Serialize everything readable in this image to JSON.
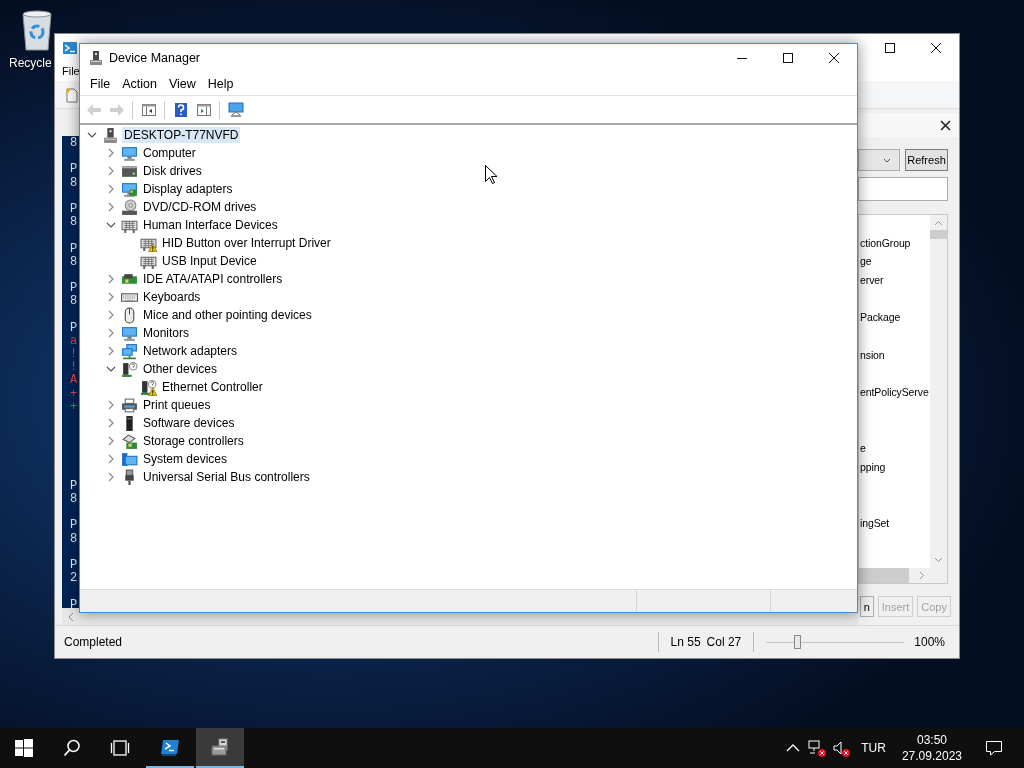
{
  "desktop_icons": [
    {
      "label": "Recycle"
    }
  ],
  "background_window": {
    "menu": [
      "File"
    ],
    "console_lines": [
      {
        "kind": "output",
        "text": "8"
      },
      {
        "kind": "blank"
      },
      {
        "kind": "output",
        "text": "P"
      },
      {
        "kind": "output",
        "text": "8"
      },
      {
        "kind": "blank"
      },
      {
        "kind": "output",
        "text": "P"
      },
      {
        "kind": "output",
        "text": "8"
      },
      {
        "kind": "blank"
      },
      {
        "kind": "output",
        "text": "P"
      },
      {
        "kind": "output",
        "text": "8"
      },
      {
        "kind": "blank"
      },
      {
        "kind": "output",
        "text": "P"
      },
      {
        "kind": "output",
        "text": "8"
      },
      {
        "kind": "blank"
      },
      {
        "kind": "output",
        "text": "P"
      },
      {
        "kind": "error",
        "text": "a"
      },
      {
        "kind": "error",
        "text": "!"
      },
      {
        "kind": "error",
        "text": "!"
      },
      {
        "kind": "error",
        "text": "A"
      },
      {
        "kind": "error",
        "text": "+"
      },
      {
        "kind": "error",
        "text": "+"
      },
      {
        "kind": "blank"
      },
      {
        "kind": "blank"
      },
      {
        "kind": "blank"
      },
      {
        "kind": "blank"
      },
      {
        "kind": "blank"
      },
      {
        "kind": "output",
        "text": "P"
      },
      {
        "kind": "output",
        "text": "8"
      },
      {
        "kind": "blank"
      },
      {
        "kind": "output",
        "text": "P"
      },
      {
        "kind": "output",
        "text": "8"
      },
      {
        "kind": "blank"
      },
      {
        "kind": "output",
        "text": "P"
      },
      {
        "kind": "output",
        "text": "2"
      },
      {
        "kind": "blank"
      },
      {
        "kind": "output",
        "text": "P"
      }
    ],
    "commands_pane": {
      "refresh_button": "Refresh",
      "commands": [
        {
          "kind": "covered"
        },
        {
          "kind": "text",
          "text": "ctionGroup"
        },
        {
          "kind": "text",
          "text": "ge"
        },
        {
          "kind": "text",
          "text": "erver"
        },
        {
          "kind": "covered"
        },
        {
          "kind": "text",
          "text": "Package"
        },
        {
          "kind": "covered"
        },
        {
          "kind": "text",
          "text": "nsion"
        },
        {
          "kind": "covered"
        },
        {
          "kind": "text",
          "text": "entPolicyServe"
        },
        {
          "kind": "covered"
        },
        {
          "kind": "covered"
        },
        {
          "kind": "text",
          "text": "e"
        },
        {
          "kind": "text",
          "text": "pping"
        },
        {
          "kind": "covered"
        },
        {
          "kind": "covered"
        },
        {
          "kind": "text",
          "text": "ingSet"
        }
      ],
      "buttons": [
        {
          "label": "n",
          "disabled": false
        },
        {
          "label": "Insert",
          "disabled": true
        },
        {
          "label": "Copy",
          "disabled": true
        }
      ]
    },
    "status_bar": {
      "status": "Completed",
      "line": "Ln 55",
      "column": "Col 27",
      "zoom": {
        "level": 0.22
      },
      "zoom_text": "100%"
    }
  },
  "device_manager": {
    "title": "Device Manager",
    "menu": [
      "File",
      "Action",
      "View",
      "Help"
    ],
    "toolbar": [
      [
        {
          "kind": "back",
          "disabled": true
        },
        {
          "kind": "forward",
          "disabled": true
        }
      ],
      [
        {
          "kind": "console_tree",
          "disabled": false
        }
      ],
      [
        {
          "kind": "help",
          "disabled": false
        },
        {
          "kind": "properties",
          "disabled": false
        }
      ],
      [
        {
          "kind": "scan",
          "disabled": false
        }
      ]
    ],
    "tree": [
      {
        "label": "DESKTOP-T77NVFD",
        "kind": "computer_root",
        "expanded": true,
        "selected": true,
        "children": [
          {
            "label": "Computer",
            "kind": "computer",
            "expanded": false,
            "selected": false
          },
          {
            "label": "Disk drives",
            "kind": "disk",
            "expanded": false,
            "selected": false
          },
          {
            "label": "Display adapters",
            "kind": "display",
            "expanded": false,
            "selected": false
          },
          {
            "label": "DVD/CD-ROM drives",
            "kind": "dvd",
            "expanded": false,
            "selected": false
          },
          {
            "label": "Human Interface Devices",
            "kind": "hid",
            "expanded": true,
            "selected": false,
            "children": [
              {
                "label": "HID Button over Interrupt Driver",
                "kind": "hid",
                "warning": true,
                "selected": false
              },
              {
                "label": "USB Input Device",
                "kind": "hid",
                "warning": false,
                "selected": false
              }
            ]
          },
          {
            "label": "IDE ATA/ATAPI controllers",
            "kind": "ide",
            "expanded": false,
            "selected": false
          },
          {
            "label": "Keyboards",
            "kind": "keyboard",
            "expanded": false,
            "selected": false
          },
          {
            "label": "Mice and other pointing devices",
            "kind": "mouse",
            "expanded": false,
            "selected": false
          },
          {
            "label": "Monitors",
            "kind": "monitor",
            "expanded": false,
            "selected": false
          },
          {
            "label": "Network adapters",
            "kind": "network",
            "expanded": false,
            "selected": false
          },
          {
            "label": "Other devices",
            "kind": "other",
            "expanded": true,
            "selected": false,
            "children": [
              {
                "label": "Ethernet Controller",
                "kind": "other",
                "warning": true,
                "selected": false
              }
            ]
          },
          {
            "label": "Print queues",
            "kind": "printer",
            "expanded": false,
            "selected": false
          },
          {
            "label": "Software devices",
            "kind": "software",
            "expanded": false,
            "selected": false
          },
          {
            "label": "Storage controllers",
            "kind": "storage",
            "expanded": false,
            "selected": false
          },
          {
            "label": "System devices",
            "kind": "system",
            "expanded": false,
            "selected": false
          },
          {
            "label": "Universal Serial Bus controllers",
            "kind": "usb",
            "expanded": false,
            "selected": false
          }
        ]
      }
    ]
  },
  "taskbar": {
    "apps": [
      {
        "kind": "terminal",
        "selected": false
      },
      {
        "kind": "device_manager",
        "selected": true
      }
    ],
    "tray": {
      "network_connected": false,
      "volume_muted": true,
      "language": "TUR",
      "time": "03:50",
      "date": "27.09.2023"
    }
  }
}
